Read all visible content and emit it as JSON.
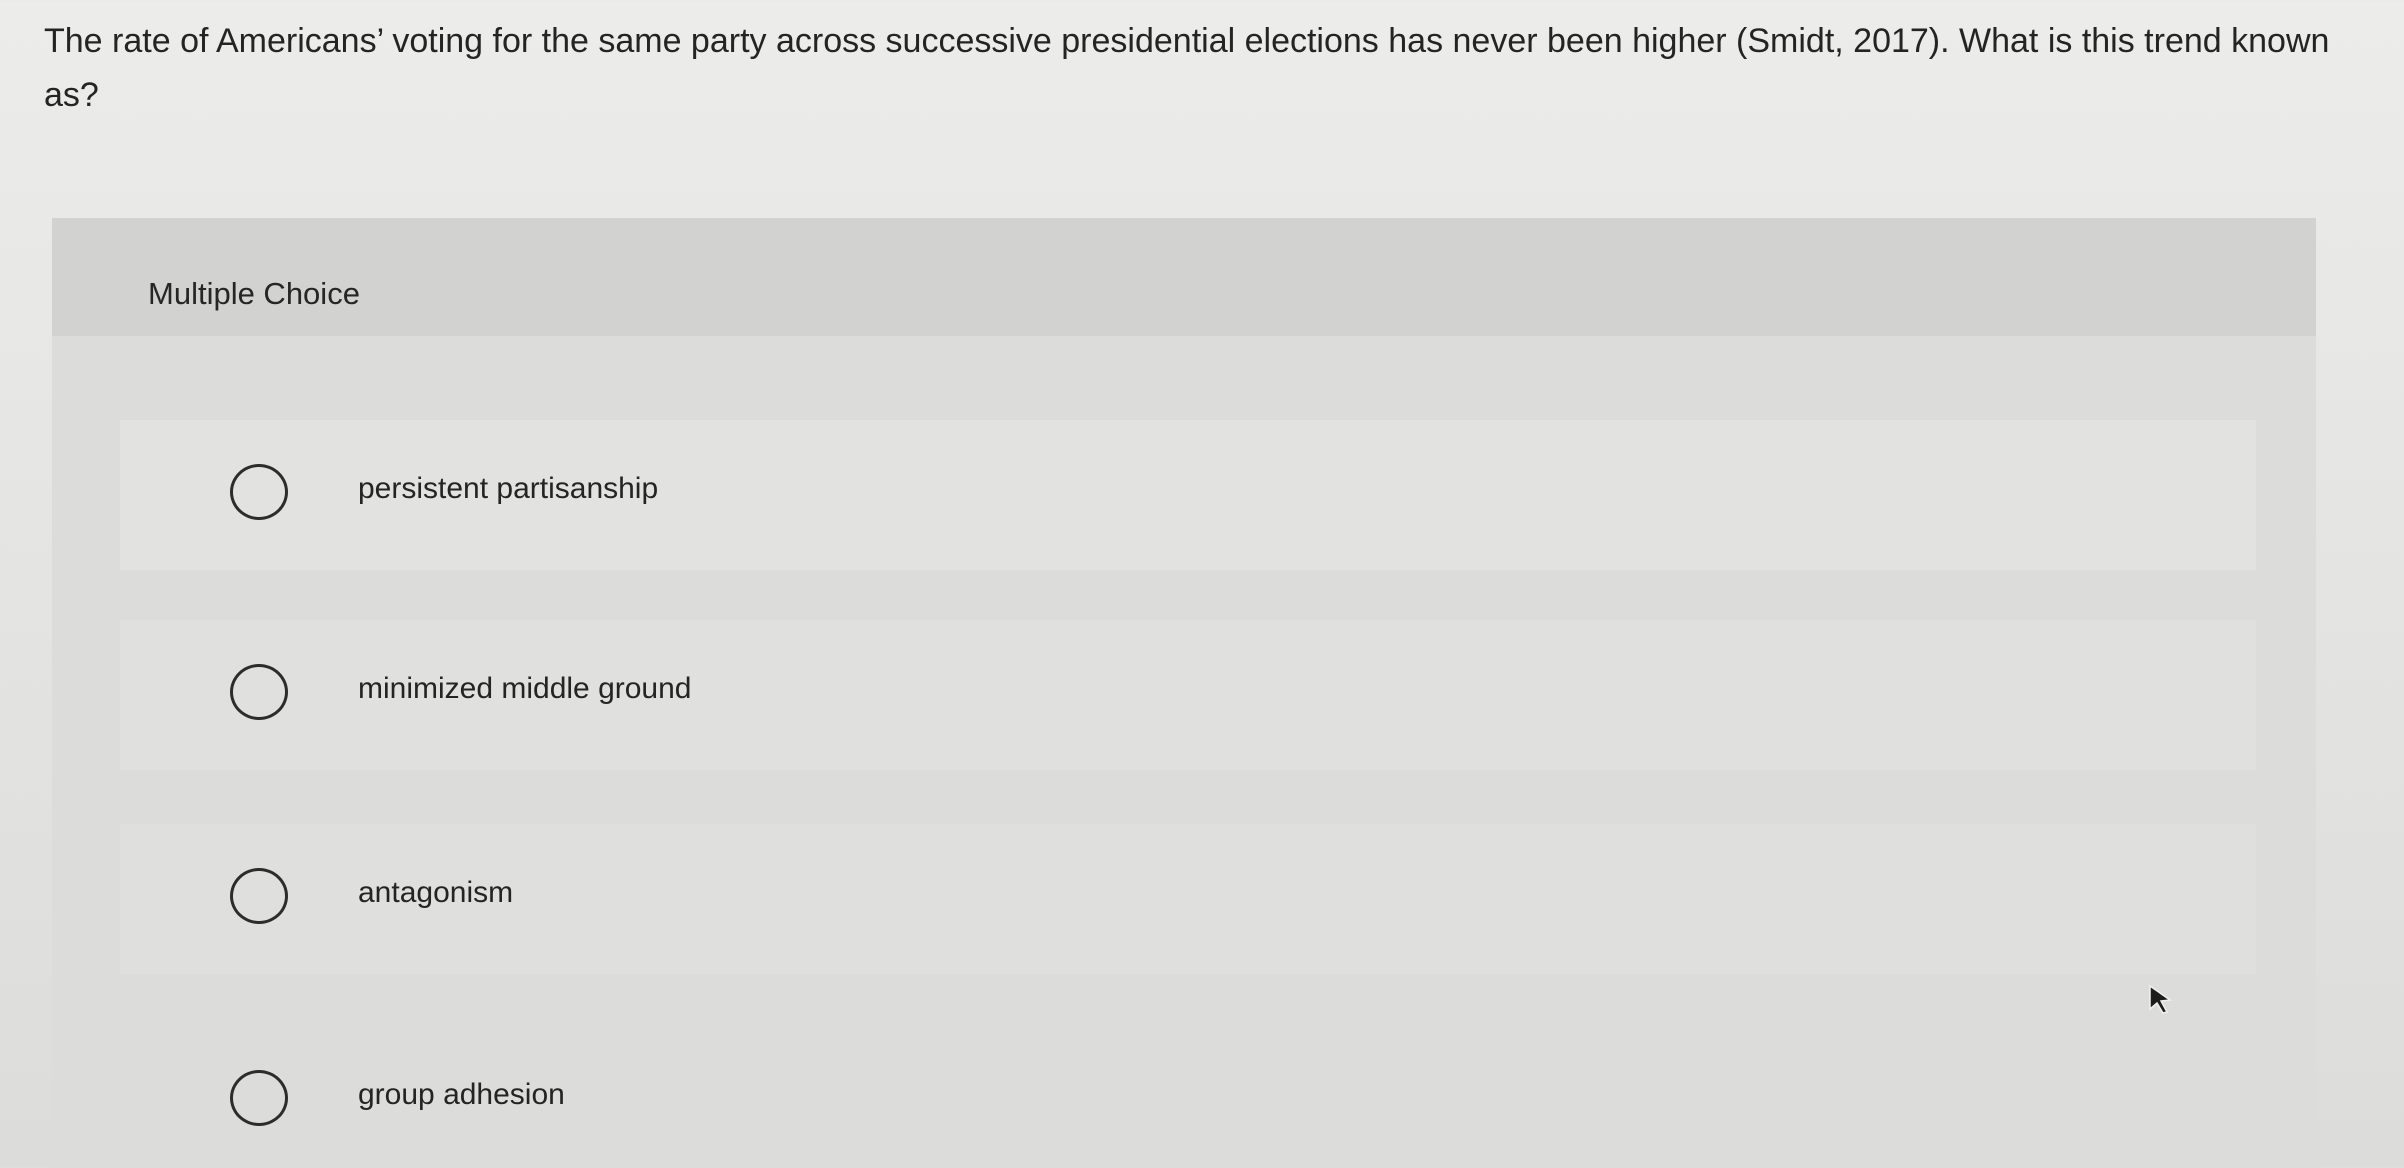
{
  "question": {
    "text": "The rate of Americans’ voting for the same party across successive presidential elections has never been higher (Smidt, 2017). What is this trend known as?"
  },
  "card": {
    "title": "Multiple Choice"
  },
  "options": [
    {
      "label": "persistent partisanship",
      "selected": false
    },
    {
      "label": "minimized middle ground",
      "selected": false
    },
    {
      "label": "antagonism",
      "selected": false
    },
    {
      "label": "group adhesion",
      "selected": false
    }
  ],
  "icons": {
    "radio": "radio-circle-icon",
    "cursor": "mouse-pointer-icon"
  },
  "colors": {
    "background": "#e6e6e4",
    "card": "#d6d6d4",
    "text": "#242424"
  }
}
